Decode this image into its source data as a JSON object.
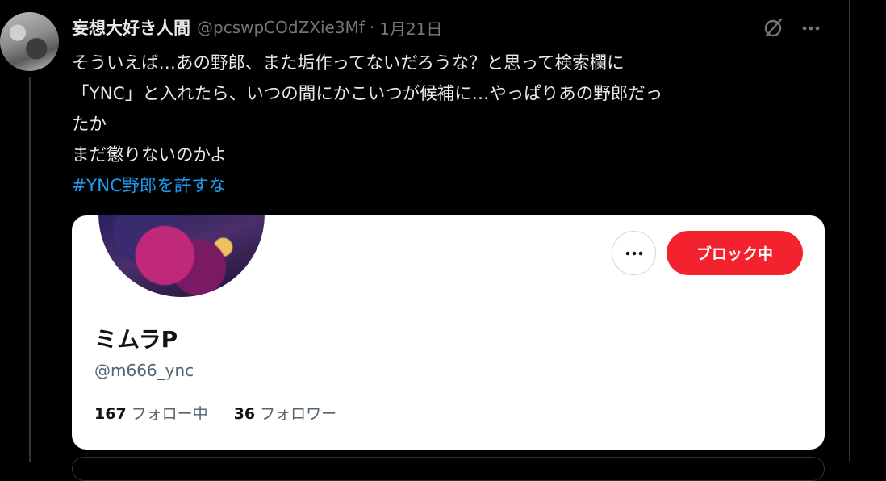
{
  "tweet": {
    "display_name": "妄想大好き人間",
    "handle": "@pcswpCOdZXie3Mf",
    "separator": "·",
    "time": "1月21日",
    "text_lines": [
      "そういえば…あの野郎、また垢作ってないだろうな？と思って検索欄に",
      "「YNC」と入れたら、いつの間にかこいつが候補に…やっぱりあの野郎だっ",
      "たか",
      "まだ懲りないのかよ"
    ],
    "hashtag": "#YNC野郎を許すな",
    "icons": {
      "grok": "grok-icon",
      "more": "more-icon"
    }
  },
  "card": {
    "name": "ミムラP",
    "handle": "@m666_ync",
    "block_label": "ブロック中",
    "following_count": "167",
    "following_label": "フォロー中",
    "followers_count": "36",
    "followers_label": "フォロワー",
    "block_color": "#f4212e"
  }
}
